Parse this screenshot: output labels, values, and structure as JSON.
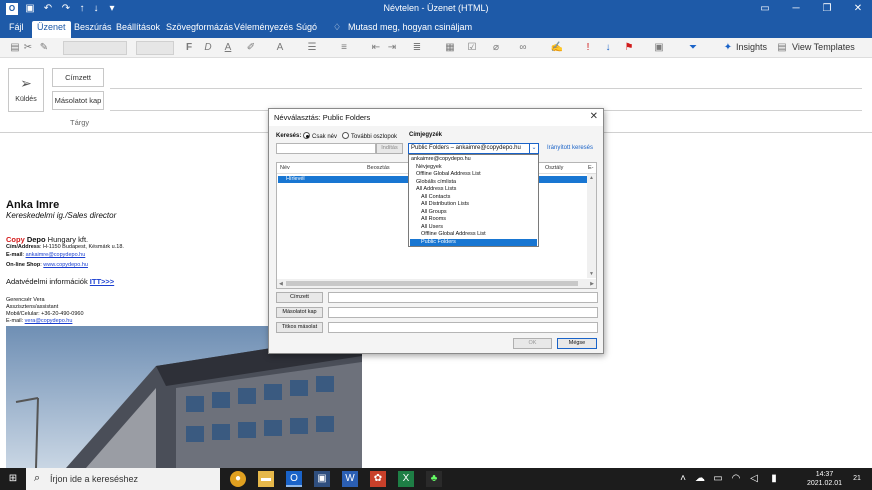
{
  "window": {
    "title": "Névtelen - Üzenet (HTML)"
  },
  "menu": [
    "Fájl",
    "Üzenet",
    "Beszúrás",
    "Beállítások",
    "Szövegformázás",
    "Véleményezés",
    "Súgó"
  ],
  "tell_me": "Mutasd meg, hogyan csináljam",
  "ribbon": {
    "insights": "Insights",
    "view_templates": "View Templates"
  },
  "compose": {
    "send": "Küldés",
    "to": "Címzett",
    "cc": "Másolatot kap",
    "subject": "Tárgy"
  },
  "signature": {
    "name": "Anka Imre",
    "role": "Kereskedelmi ig./Sales director",
    "company_red": "Copy",
    "company_bold": " Depo",
    "company_rest": " Hungary kft.",
    "address_label": "Cím/Address",
    "address": ": H-1150 Budapest, Késmárk u.18.",
    "email_label": "E-mail",
    "email": "ankaimre@copydepo.hu",
    "shop_label": "On-line Shop",
    "shop": "www.copydepo.hu",
    "privacy_text": "Adatvédelmi információk ",
    "privacy_link": "ITT>>>",
    "assistant_name": "Gerencsér Vera",
    "assistant_role": "Asszisztens/assistant",
    "assistant_phone": "Mobil/Celular: +36-20-490-0960",
    "assistant_email_label": "E-mail: ",
    "assistant_email": "vera@copydepo.hu"
  },
  "dialog": {
    "title": "Névválasztás: Public Folders",
    "search_label": "Keresés:",
    "radio_name": "Csak név",
    "radio_more": "További oszlopok",
    "go_button": "Indítás",
    "address_book_label": "Címjegyzék",
    "address_book_value": "Public Folders – ankaimre@copydepo.hu",
    "advanced_link": "Irányított keresés",
    "columns": [
      "Név",
      "Beosztás",
      "Osztály",
      "E-m"
    ],
    "row": "Hírlevél",
    "dropdown": [
      "ankaimre@copydepo.hu",
      "Névjegyek",
      "Offline Global Address List",
      "Globális címlista",
      "All Address Lists",
      "All Contacts",
      "All Distribution Lists",
      "All Groups",
      "All Rooms",
      "All Users",
      "Offline Global Address List",
      "Public Folders"
    ],
    "to_button": "Címzett",
    "cc_button": "Másolatot kap",
    "bcc_button": "Titkos másolat",
    "ok_button": "OK",
    "cancel_button": "Mégse"
  },
  "taskbar": {
    "search": "Írjon ide a kereséshez",
    "time": "14:37",
    "date": "2021.02.01",
    "notifications": "21"
  }
}
